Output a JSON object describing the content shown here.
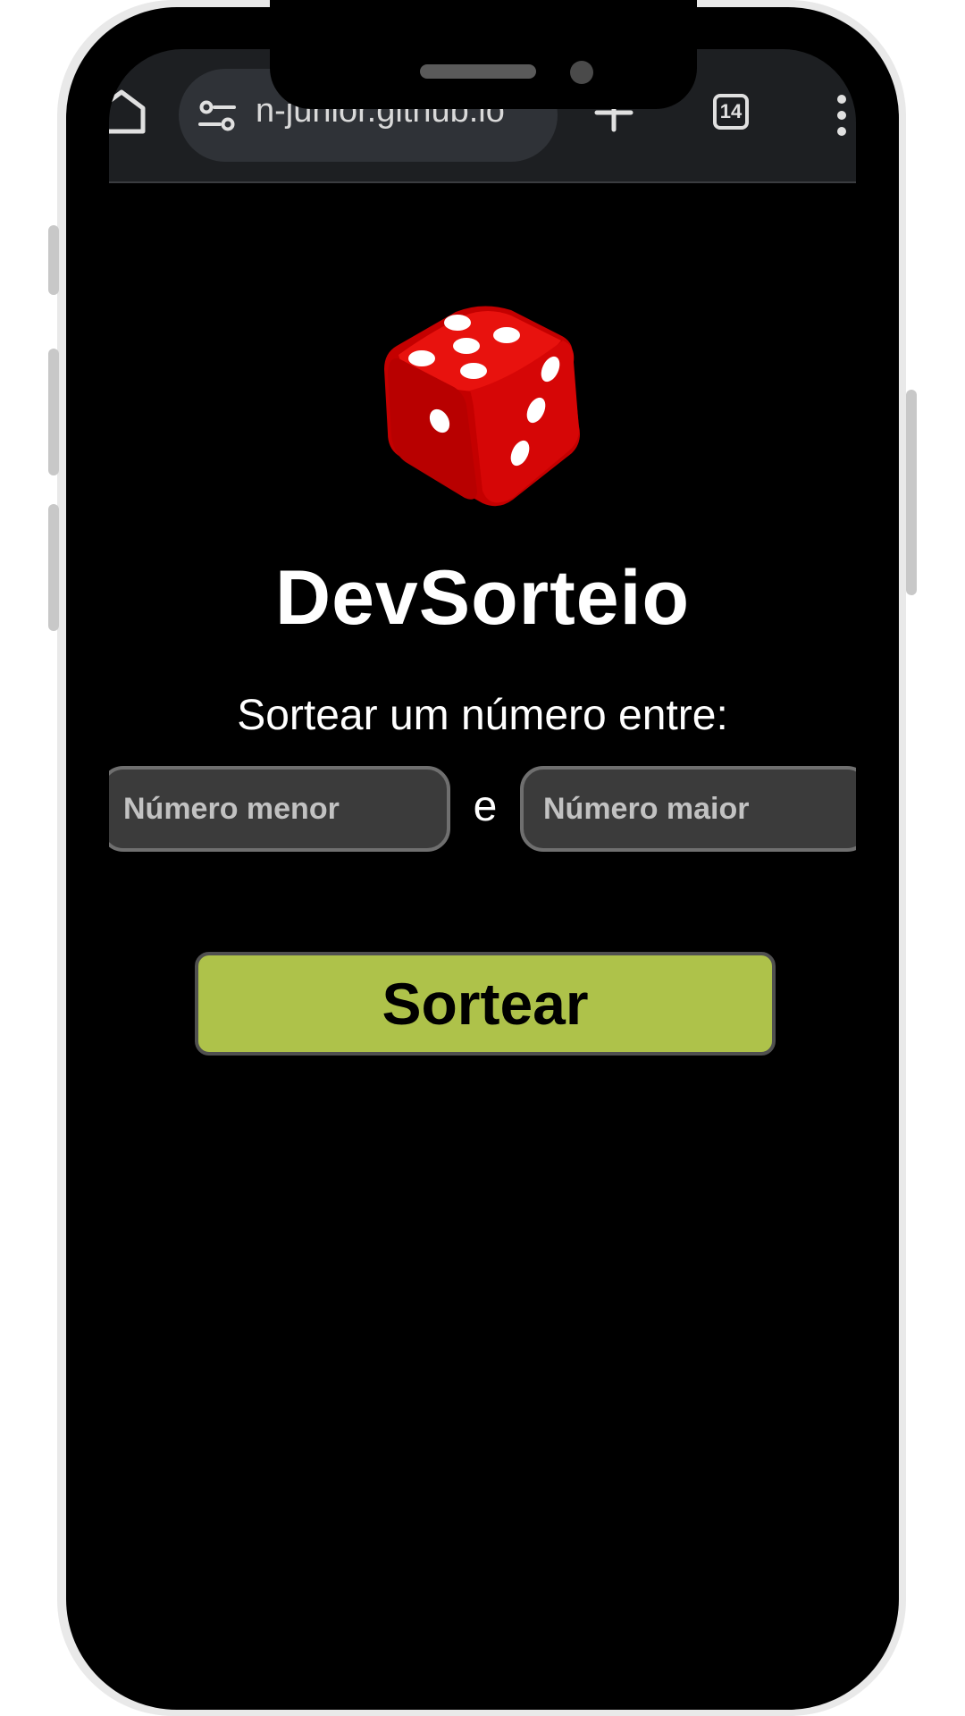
{
  "browser": {
    "url_text": "n-junior.github.io",
    "tab_count": "14"
  },
  "app": {
    "title": "DevSorteio",
    "prompt": "Sortear um número entre:",
    "min_input": {
      "placeholder": "Número menor",
      "value": ""
    },
    "separator": "e",
    "max_input": {
      "placeholder": "Número maior",
      "value": ""
    },
    "draw_button_label": "Sortear"
  },
  "icons": {
    "home": "home-icon",
    "site_settings": "tune-icon",
    "new_tab": "plus-icon",
    "tabs": "tab-switcher-icon",
    "menu": "more-vert-icon",
    "logo": "dice-icon"
  },
  "colors": {
    "page_background": "#000000",
    "button_accent": "#aec24a",
    "input_background": "#3b3b3b",
    "toolbar_background": "#1d1f22"
  }
}
